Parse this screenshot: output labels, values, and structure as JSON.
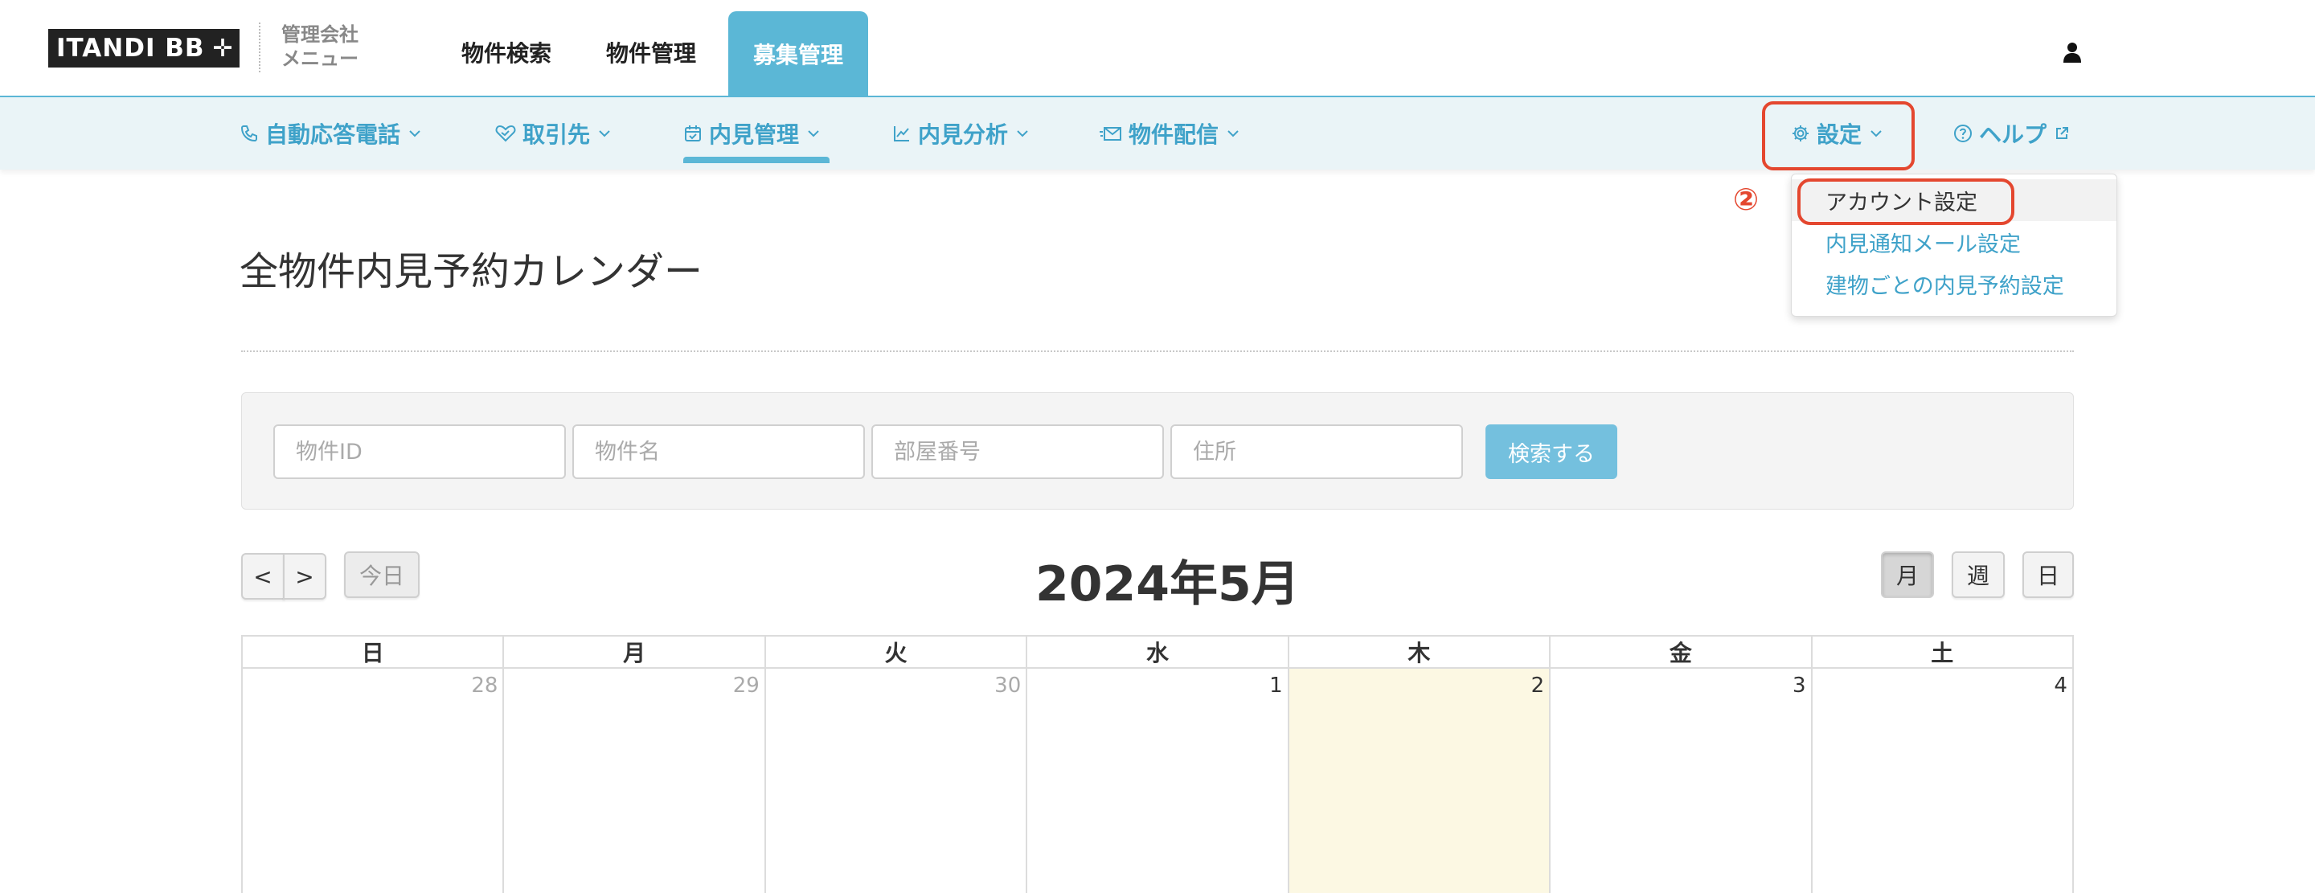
{
  "header": {
    "logo_text": "ITANDI BB",
    "logo_plus": "✛",
    "mgmt_menu_line1": "管理会社",
    "mgmt_menu_line2": "メニュー",
    "nav": [
      "物件検索",
      "物件管理",
      "募集管理"
    ],
    "active_nav": "募集管理"
  },
  "subnav": {
    "phone": "自動応答電話",
    "partner": "取引先",
    "viewing": "内見管理",
    "analysis": "内見分析",
    "delivery": "物件配信",
    "settings": "設定",
    "help": "ヘルプ"
  },
  "dropdown": {
    "items": [
      "アカウント設定",
      "内見通知メール設定",
      "建物ごとの内見予約設定"
    ]
  },
  "annotation": {
    "step": "②",
    "color": "#e4472f"
  },
  "page": {
    "title": "全物件内見予約カレンダー"
  },
  "search": {
    "placeholders": [
      "物件ID",
      "物件名",
      "部屋番号",
      "住所"
    ],
    "button": "検索する"
  },
  "calendar": {
    "prev": "<",
    "next": ">",
    "today": "今日",
    "title": "2024年5月",
    "views": [
      "月",
      "週",
      "日"
    ],
    "active_view": "月",
    "weekdays": [
      "日",
      "月",
      "火",
      "水",
      "木",
      "金",
      "土"
    ],
    "days": [
      {
        "num": "28",
        "other_month": true
      },
      {
        "num": "29",
        "other_month": true
      },
      {
        "num": "30",
        "other_month": true
      },
      {
        "num": "1",
        "other_month": false
      },
      {
        "num": "2",
        "other_month": false,
        "today": true
      },
      {
        "num": "3",
        "other_month": false
      },
      {
        "num": "4",
        "other_month": false
      }
    ]
  },
  "colors": {
    "accent": "#5bb7d6",
    "link": "#3fa2c9",
    "today_bg": "#fcf8e3"
  }
}
